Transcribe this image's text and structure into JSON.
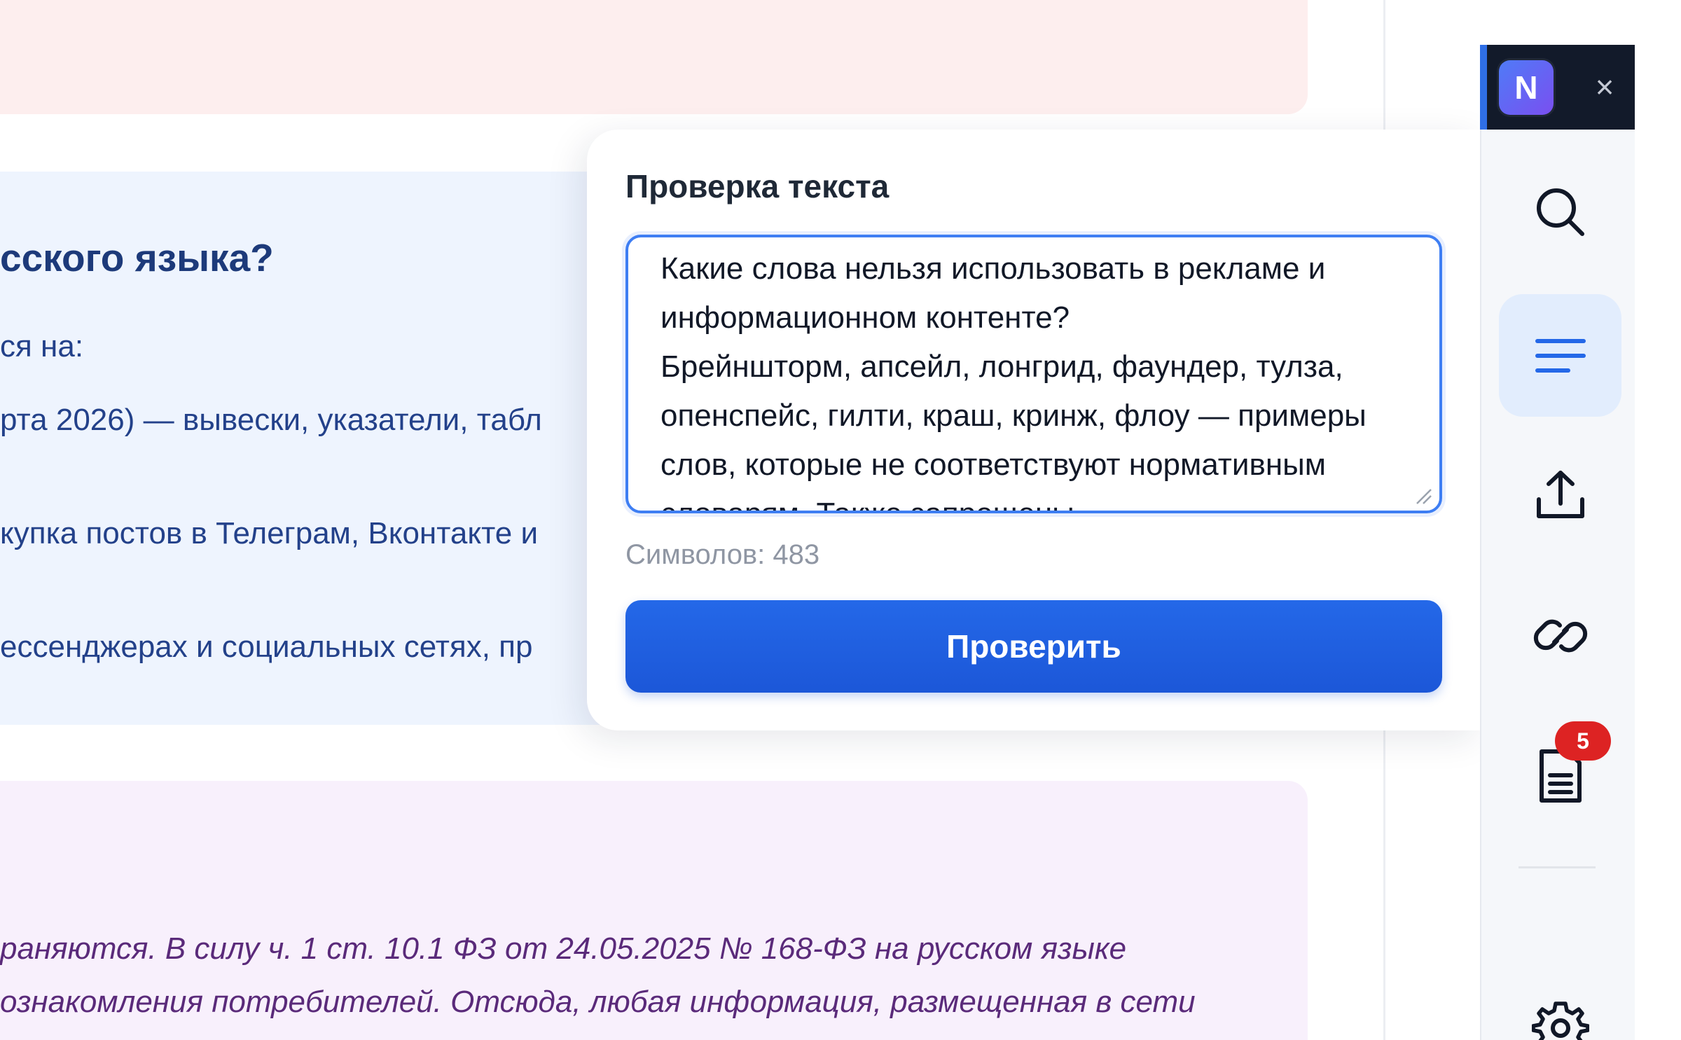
{
  "background_page": {
    "heading": "сского языка?",
    "lines": [
      "ся на:",
      "рта 2026) — вывески, указатели, табл",
      "купка постов в Телеграм, Вконтакте и",
      "ессенджерах и социальных сетях, пр"
    ],
    "italic_lines": [
      "раняются. В силу ч. 1 ст. 10.1 ФЗ от 24.05.2025 № 168-ФЗ на русском языке",
      "ознакомления потребителей. Отсюда, любая информация, размещенная в сети"
    ]
  },
  "extension": {
    "logo_letter": "N",
    "close_glyph": "×",
    "sidebar": {
      "items": [
        {
          "name": "search-icon"
        },
        {
          "name": "text-lines-icon",
          "active": true
        },
        {
          "name": "upload-icon"
        },
        {
          "name": "link-icon"
        },
        {
          "name": "document-icon",
          "badge": "5"
        },
        {
          "name": "gear-icon"
        }
      ]
    },
    "panel": {
      "title": "Проверка текста",
      "textarea_value": "Какие слова нельзя использовать в рекламе и информационном контенте?\nБрейншторм, апсейл, лонгрид, фаундер, тулза, опенспейс, гилти, краш, кринж, флоу — примеры слов, которые не соответствуют нормативным словарям. Также запрещены",
      "char_count_label": "Символов: 483",
      "check_button": "Проверить"
    }
  },
  "colors": {
    "accent": "#2468e8",
    "header_bg": "#121a2a",
    "badge": "#dd2323"
  }
}
